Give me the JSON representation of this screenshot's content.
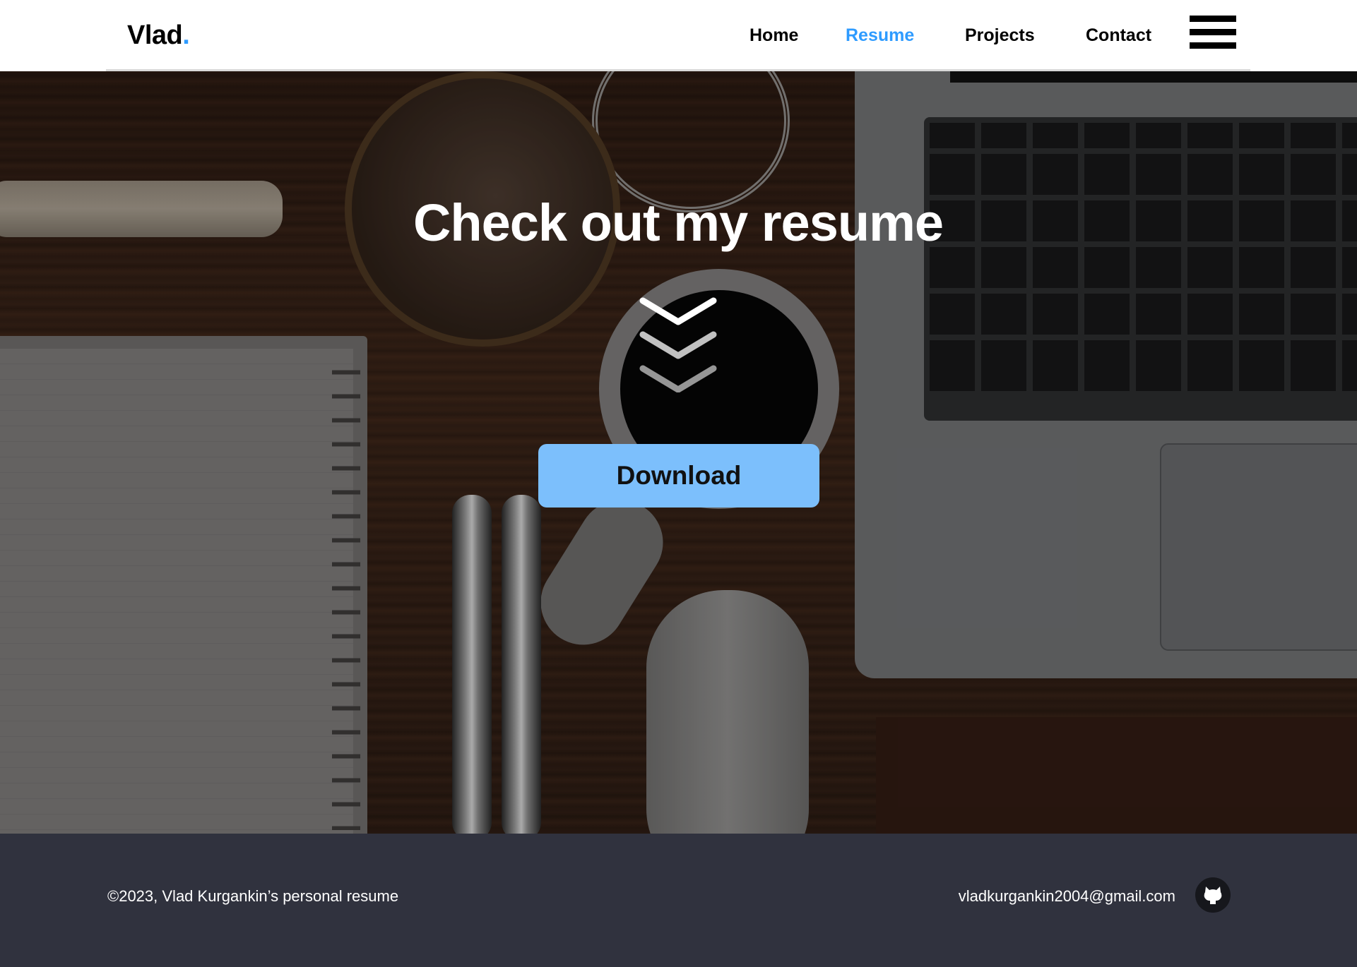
{
  "header": {
    "logo_text": "Vlad",
    "logo_dot": ".",
    "nav": [
      {
        "label": "Home",
        "active": false
      },
      {
        "label": "Resume",
        "active": true
      },
      {
        "label": "Projects",
        "active": false
      },
      {
        "label": "Contact",
        "active": false
      }
    ],
    "menu_icon": "hamburger-menu-icon"
  },
  "hero": {
    "title": "Check out my resume",
    "scroll_icon": "triple-chevron-down-icon",
    "download_label": "Download"
  },
  "footer": {
    "copyright": "©2023, Vlad Kurgankin’s personal resume",
    "email": "vladkurgankin2004@gmail.com",
    "github_icon": "github-icon"
  },
  "colors": {
    "accent": "#2e9bff",
    "button": "#7cbffc",
    "footer_bg": "#30323e",
    "text_dark": "#000000",
    "text_light": "#ffffff"
  }
}
